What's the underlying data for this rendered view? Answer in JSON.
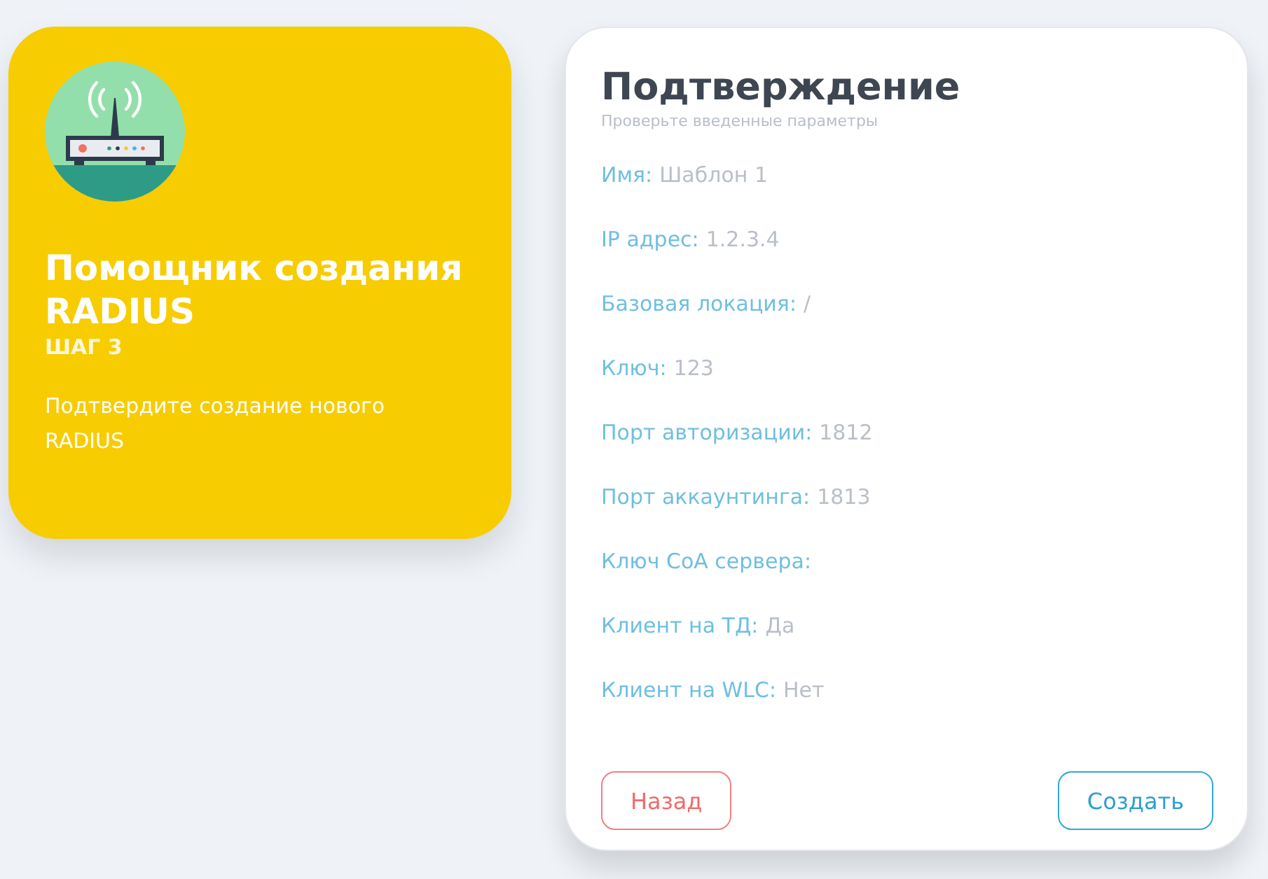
{
  "wizard": {
    "title": "Помощник создания RADIUS",
    "step": "ШАГ 3",
    "description": "Подтвердите создание нового RADIUS"
  },
  "confirmation": {
    "title": "Подтверждение",
    "subtitle": "Проверьте введенные параметры",
    "fields": [
      {
        "label": "Имя:",
        "value": "Шаблон 1"
      },
      {
        "label": "IP адрес:",
        "value": "1.2.3.4"
      },
      {
        "label": "Базовая локация:",
        "value": "/"
      },
      {
        "label": "Ключ:",
        "value": "123"
      },
      {
        "label": "Порт авторизации:",
        "value": "1812"
      },
      {
        "label": "Порт аккаунтинга:",
        "value": "1813"
      },
      {
        "label": "Ключ CoA сервера:"
      },
      {
        "label": "Клиент на ТД:",
        "value": "Да"
      },
      {
        "label": "Клиент на WLC:",
        "value": "Нет"
      }
    ],
    "buttons": [
      {
        "label": "Назад",
        "kind": "back"
      },
      {
        "label": "Создать",
        "kind": "primary"
      }
    ]
  }
}
